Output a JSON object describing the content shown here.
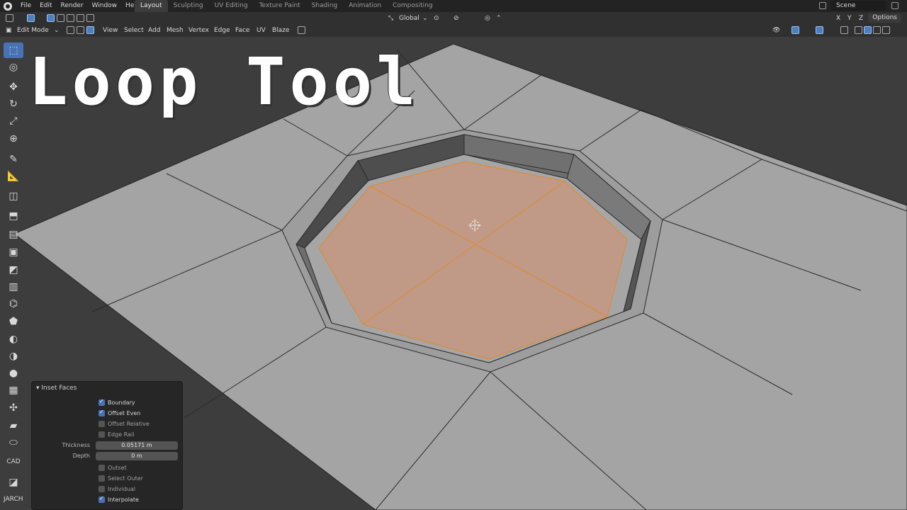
{
  "menu": [
    "File",
    "Edit",
    "Render",
    "Window",
    "Help"
  ],
  "workspaces": [
    "Layout",
    "Sculpting",
    "UV Editing",
    "Texture Paint",
    "Shading",
    "Animation",
    "Compositing"
  ],
  "active_workspace": "Layout",
  "scene_name": "Scene",
  "header": {
    "transform_orientation": "Global",
    "options_label": "Options",
    "mode": "Edit Mode",
    "menus": [
      "View",
      "Select",
      "Add",
      "Mesh",
      "Vertex",
      "Edge",
      "Face",
      "UV",
      "Blaze"
    ]
  },
  "overlay_title": "Loop Tool",
  "operator_panel": {
    "title": "Inset Faces",
    "checkboxes": [
      {
        "label": "Boundary",
        "checked": true
      },
      {
        "label": "Offset Even",
        "checked": true
      },
      {
        "label": "Offset Relative",
        "checked": false
      },
      {
        "label": "Edge Rail",
        "checked": false
      }
    ],
    "fields": [
      {
        "label": "Thickness",
        "value": "0.05171 m"
      },
      {
        "label": "Depth",
        "value": "0 m"
      }
    ],
    "checkboxes2": [
      {
        "label": "Outset",
        "checked": false
      },
      {
        "label": "Select Outer",
        "checked": false
      },
      {
        "label": "Individual",
        "checked": false
      },
      {
        "label": "Interpolate",
        "checked": true
      }
    ]
  },
  "bottom_label": "JARCH",
  "cad_label": "CAD",
  "colors": {
    "selected_face": "#c09a86",
    "plane": "#a3a3a3",
    "accent": "#4772b3",
    "selection_edge": "#e08a2a"
  }
}
